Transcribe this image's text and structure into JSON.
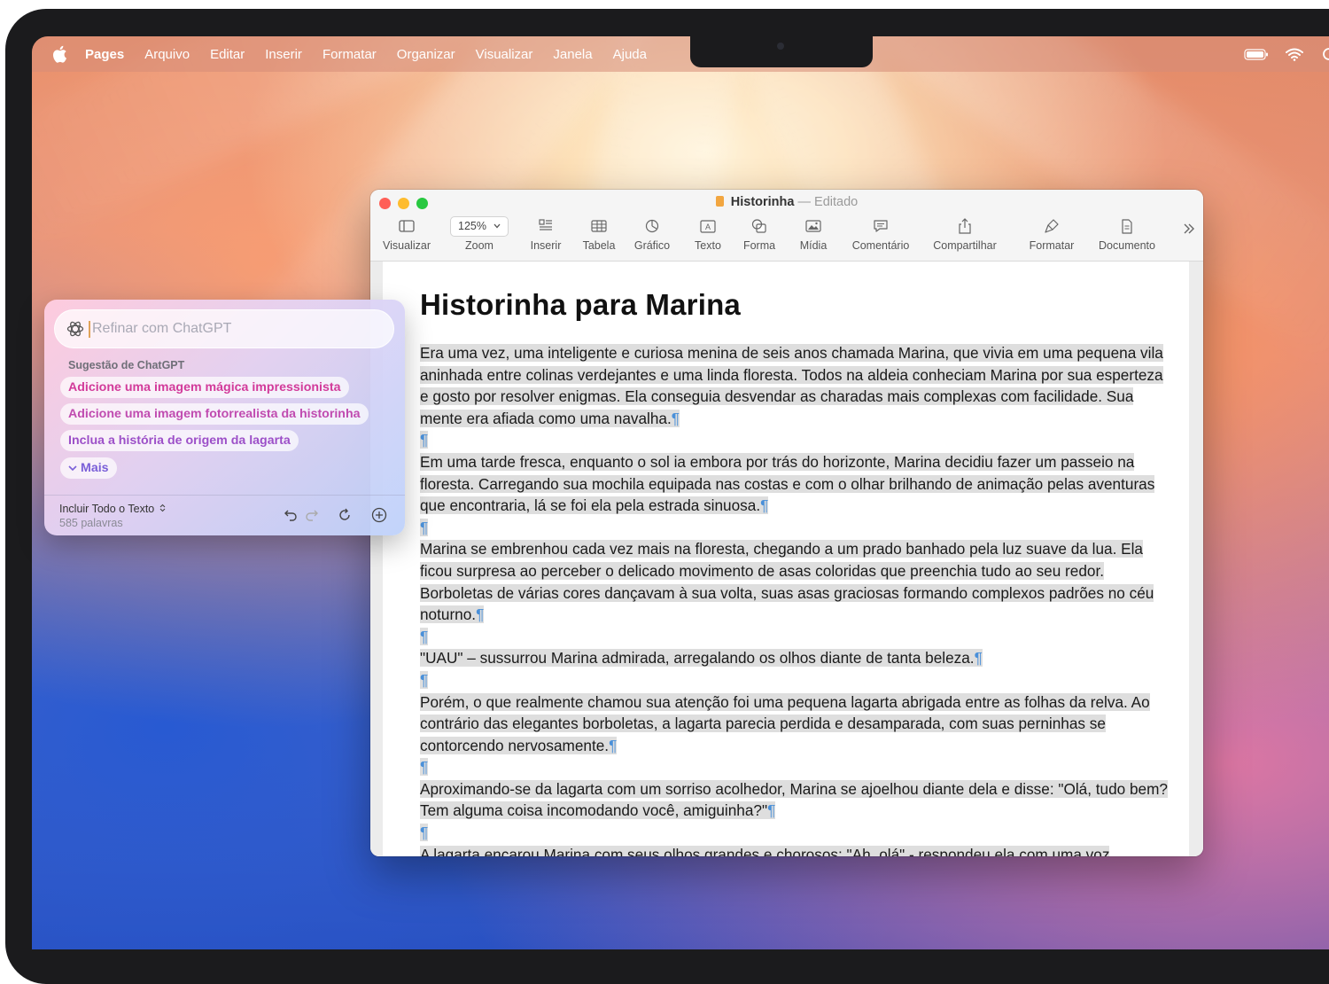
{
  "menubar": {
    "app_name": "Pages",
    "items": [
      "Arquivo",
      "Editar",
      "Inserir",
      "Formatar",
      "Organizar",
      "Visualizar",
      "Janela",
      "Ajuda"
    ]
  },
  "window": {
    "title": "Historinha",
    "separator": "—",
    "status": "Editado",
    "toolbar": {
      "view": "Visualizar",
      "zoom_value": "125%",
      "zoom": "Zoom",
      "insert": "Inserir",
      "table": "Tabela",
      "chart": "Gráfico",
      "text": "Texto",
      "shape": "Forma",
      "media": "Mídia",
      "comment": "Comentário",
      "share": "Compartilhar",
      "format": "Formatar",
      "document": "Documento"
    }
  },
  "document": {
    "heading": "Historinha para Marina",
    "paragraphs": [
      "Era uma vez, uma inteligente e curiosa menina de seis anos chamada Marina, que vivia em uma pequena vila aninhada entre colinas verdejantes e uma linda floresta. Todos na aldeia conheciam Marina por sua esperteza e gosto por resolver enigmas. Ela conseguia desvendar as charadas mais complexas com facilidade. Sua mente era afiada como uma navalha.",
      "Em uma tarde fresca, enquanto o sol ia embora por trás do horizonte, Marina decidiu fazer um passeio na floresta. Carregando sua mochila equipada nas costas e com o olhar brilhando de animação pelas aventuras que encontraria, lá se foi ela pela estrada sinuosa.",
      "Marina se embrenhou cada vez mais na floresta, chegando a um prado banhado pela luz suave da lua. Ela ficou surpresa ao perceber o delicado movimento de asas coloridas que preenchia tudo ao seu redor. Borboletas de várias cores dançavam à sua volta, suas asas graciosas formando complexos padrões no céu noturno.",
      "\"UAU\" – sussurrou Marina admirada, arregalando os olhos diante de tanta beleza.",
      "Porém, o que realmente chamou sua atenção foi uma pequena lagarta abrigada entre as folhas da relva. Ao contrário das elegantes borboletas, a lagarta parecia perdida e desamparada, com suas perninhas se contorcendo nervosamente.",
      "Aproximando-se da lagarta com um sorriso acolhedor, Marina se ajoelhou diante dela e disse: \"Olá, tudo bem? Tem alguma coisa incomodando você, amiguinha?\"",
      "A lagarta encarou Marina com seus olhos grandes e chorosos: \"Ah, olá\" - respondeu ela com uma voz"
    ],
    "pilcrow": "¶"
  },
  "panel": {
    "placeholder": "Refinar com ChatGPT",
    "suggestions_heading": "Sugestão de ChatGPT",
    "suggestions": [
      "Adicione uma imagem mágica impressionista",
      "Adicione uma imagem fotorrealista da historinha",
      "Inclua a história de origem da lagarta"
    ],
    "more": "Mais",
    "include_label": "Incluir Todo o Texto",
    "word_count": "585 palavras"
  },
  "colors": {
    "selection": "#dedede",
    "pilcrow": "#4a90d9",
    "chip_pink": "#d23a9a",
    "chip_purple": "#9c4fc8"
  }
}
